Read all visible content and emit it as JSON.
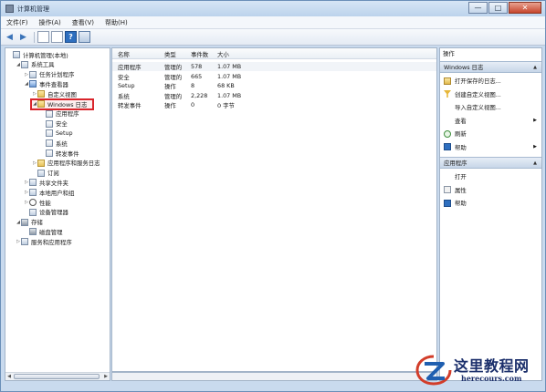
{
  "window": {
    "title": "计算机管理"
  },
  "window_buttons": {
    "minimize": "—",
    "maximize": "□",
    "close": "✕"
  },
  "menu": [
    "文件(F)",
    "操作(A)",
    "查看(V)",
    "帮助(H)"
  ],
  "tree": [
    {
      "label": "计算机管理(本地)",
      "indent": 0,
      "expander": "",
      "icon": "computer-icon"
    },
    {
      "label": "系统工具",
      "indent": 1,
      "expander": "◢",
      "icon": "tools-icon"
    },
    {
      "label": "任务计划程序",
      "indent": 2,
      "expander": "▷",
      "icon": "clock-icon"
    },
    {
      "label": "事件查看器",
      "indent": 2,
      "expander": "◢",
      "icon": "event-viewer-icon"
    },
    {
      "label": "自定义视图",
      "indent": 3,
      "expander": "▷",
      "icon": "folder-icon"
    },
    {
      "label": "Windows 日志",
      "indent": 3,
      "expander": "◢",
      "icon": "folder-icon",
      "selected": true
    },
    {
      "label": "应用程序",
      "indent": 4,
      "expander": "",
      "icon": "log-icon"
    },
    {
      "label": "安全",
      "indent": 4,
      "expander": "",
      "icon": "log-icon"
    },
    {
      "label": "Setup",
      "indent": 4,
      "expander": "",
      "icon": "log-icon"
    },
    {
      "label": "系统",
      "indent": 4,
      "expander": "",
      "icon": "log-icon"
    },
    {
      "label": "转发事件",
      "indent": 4,
      "expander": "",
      "icon": "log-icon"
    },
    {
      "label": "应用程序和服务日志",
      "indent": 3,
      "expander": "▷",
      "icon": "folder-icon"
    },
    {
      "label": "订阅",
      "indent": 3,
      "expander": "",
      "icon": "subscription-icon"
    },
    {
      "label": "共享文件夹",
      "indent": 2,
      "expander": "▷",
      "icon": "shared-folder-icon"
    },
    {
      "label": "本地用户和组",
      "indent": 2,
      "expander": "▷",
      "icon": "users-icon"
    },
    {
      "label": "性能",
      "indent": 2,
      "expander": "▷",
      "icon": "performance-icon"
    },
    {
      "label": "设备管理器",
      "indent": 2,
      "expander": "",
      "icon": "device-manager-icon"
    },
    {
      "label": "存储",
      "indent": 1,
      "expander": "◢",
      "icon": "storage-icon"
    },
    {
      "label": "磁盘管理",
      "indent": 2,
      "expander": "",
      "icon": "disk-icon"
    },
    {
      "label": "服务和应用程序",
      "indent": 1,
      "expander": "▷",
      "icon": "services-icon"
    }
  ],
  "tree_scrollbar": {
    "left_arrow": "◀",
    "right_arrow": "▶",
    "grip": "III"
  },
  "list": {
    "columns": [
      "名称",
      "类型",
      "事件数",
      "大小"
    ],
    "rows": [
      [
        "应用程序",
        "管理的",
        "578",
        "1.07 MB"
      ],
      [
        "安全",
        "管理的",
        "665",
        "1.07 MB"
      ],
      [
        "Setup",
        "操作",
        "8",
        "68 KB"
      ],
      [
        "系统",
        "管理的",
        "2,228",
        "1.07 MB"
      ],
      [
        "转发事件",
        "操作",
        "0",
        "0 字节"
      ]
    ]
  },
  "actions": {
    "header": "操作",
    "section1": {
      "title": "Windows 日志",
      "items": [
        {
          "label": "打开保存的日志...",
          "icon": "open-folder-icon",
          "submenu": false
        },
        {
          "label": "创建自定义视图...",
          "icon": "filter-icon",
          "submenu": false
        },
        {
          "label": "导入自定义视图...",
          "icon": "",
          "submenu": false
        },
        {
          "label": "查看",
          "icon": "",
          "submenu": true
        },
        {
          "label": "刷新",
          "icon": "refresh-icon",
          "submenu": false
        },
        {
          "label": "帮助",
          "icon": "help-icon",
          "submenu": true
        }
      ]
    },
    "section2": {
      "title": "应用程序",
      "items": [
        {
          "label": "打开",
          "icon": "",
          "submenu": false
        },
        {
          "label": "属性",
          "icon": "properties-icon",
          "submenu": false
        },
        {
          "label": "帮助",
          "icon": "help-icon",
          "submenu": false
        }
      ]
    }
  },
  "watermark": {
    "title": "这里教程网",
    "url": "herecours.com"
  }
}
